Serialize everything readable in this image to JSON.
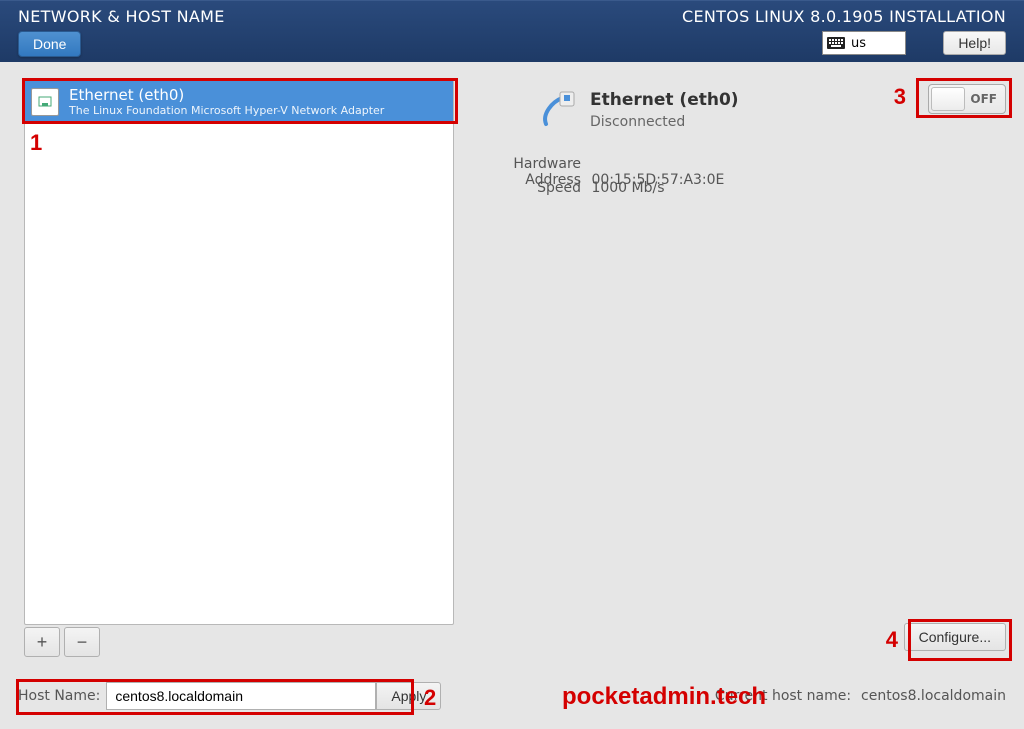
{
  "header": {
    "title": "NETWORK & HOST NAME",
    "installer_title": "CENTOS LINUX 8.0.1905 INSTALLATION",
    "done_label": "Done",
    "keyboard_layout": "us",
    "help_label": "Help!"
  },
  "interfaces": [
    {
      "name": "Ethernet (eth0)",
      "adapter": "The Linux Foundation Microsoft Hyper-V Network Adapter",
      "selected": true
    }
  ],
  "list_buttons": {
    "add": "+",
    "remove": "−"
  },
  "details": {
    "name": "Ethernet (eth0)",
    "status": "Disconnected",
    "hw_label": "Hardware Address",
    "hw_value": "00:15:5D:57:A3:0E",
    "speed_label": "Speed",
    "speed_value": "1000 Mb/s",
    "toggle_state": "OFF",
    "configure_label": "Configure..."
  },
  "hostname": {
    "label": "Host Name:",
    "value": "centos8.localdomain",
    "apply_label": "Apply",
    "current_label": "Current host name:",
    "current_value": "centos8.localdomain"
  },
  "annotations": {
    "n1": "1",
    "n2": "2",
    "n3": "3",
    "n4": "4",
    "watermark": "pocketadmin.tech"
  }
}
